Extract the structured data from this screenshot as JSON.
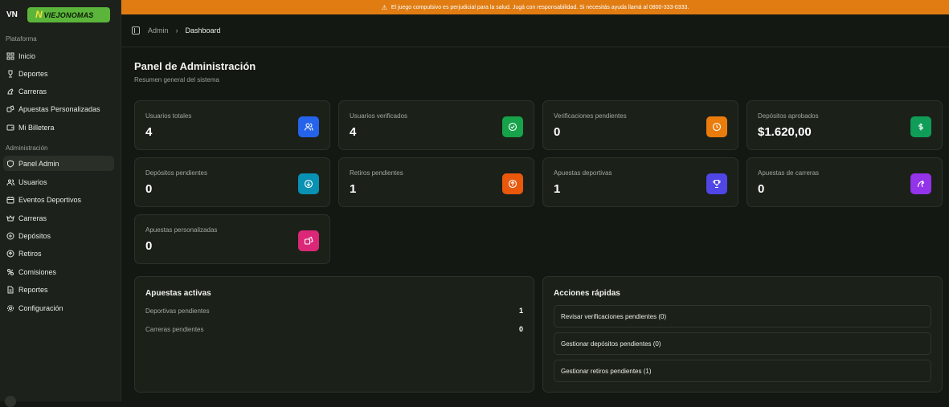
{
  "brand": {
    "short": "VN",
    "logo_text": "VIEJONOMAS"
  },
  "sidebar": {
    "section1": "Plataforma",
    "items1": [
      {
        "label": "Inicio",
        "icon": "grid-icon"
      },
      {
        "label": "Deportes",
        "icon": "trophy-icon"
      },
      {
        "label": "Carreras",
        "icon": "horse-icon"
      },
      {
        "label": "Apuestas Personalizadas",
        "icon": "dice-icon"
      },
      {
        "label": "Mi Billetera",
        "icon": "wallet-icon"
      }
    ],
    "section2": "Administración",
    "items2": [
      {
        "label": "Panel Admin",
        "icon": "shield-icon"
      },
      {
        "label": "Usuarios",
        "icon": "users-icon"
      },
      {
        "label": "Eventos Deportivos",
        "icon": "calendar-icon"
      },
      {
        "label": "Carreras",
        "icon": "crown-icon"
      },
      {
        "label": "Depósitos",
        "icon": "deposit-icon"
      },
      {
        "label": "Retiros",
        "icon": "withdraw-icon"
      },
      {
        "label": "Comisiones",
        "icon": "percent-icon"
      },
      {
        "label": "Reportes",
        "icon": "report-icon"
      },
      {
        "label": "Configuración",
        "icon": "gear-icon"
      }
    ]
  },
  "banner": {
    "text": "El juego compulsivo es perjudicial para la salud. Jugá con responsabilidad. Si necesitás ayuda llamá al 0800-333-0333."
  },
  "breadcrumb": {
    "root": "Admin",
    "current": "Dashboard"
  },
  "header": {
    "title": "Panel de Administración",
    "subtitle": "Resumen general del sistema"
  },
  "stats": [
    {
      "label": "Usuarios totales",
      "value": "4",
      "color": "#2563eb",
      "icon": "users-icon"
    },
    {
      "label": "Usuarios verificados",
      "value": "4",
      "color": "#16a34a",
      "icon": "check-circle-icon"
    },
    {
      "label": "Verificaciones pendientes",
      "value": "0",
      "color": "#ea7c0c",
      "icon": "clock-icon"
    },
    {
      "label": "Depósitos aprobados",
      "value": "$1.620,00",
      "color": "#0f9d58",
      "icon": "dollar-icon"
    },
    {
      "label": "Depósitos pendientes",
      "value": "0",
      "color": "#0891b2",
      "icon": "arrow-down-circle-icon"
    },
    {
      "label": "Retiros pendientes",
      "value": "1",
      "color": "#ea580c",
      "icon": "arrow-up-circle-icon"
    },
    {
      "label": "Apuestas deportivas",
      "value": "1",
      "color": "#4f46e5",
      "icon": "trophy-icon"
    },
    {
      "label": "Apuestas de carreras",
      "value": "0",
      "color": "#9333ea",
      "icon": "horse-icon"
    },
    {
      "label": "Apuestas personalizadas",
      "value": "0",
      "color": "#db2777",
      "icon": "dice-icon"
    }
  ],
  "active_bets": {
    "title": "Apuestas activas",
    "rows": [
      {
        "label": "Deportivas pendientes",
        "value": "1"
      },
      {
        "label": "Carreras pendientes",
        "value": "0"
      }
    ]
  },
  "quick_actions": {
    "title": "Acciones rápidas",
    "buttons": [
      "Revisar verificaciones pendientes (0)",
      "Gestionar depósitos pendientes (0)",
      "Gestionar retiros pendientes (1)"
    ]
  }
}
